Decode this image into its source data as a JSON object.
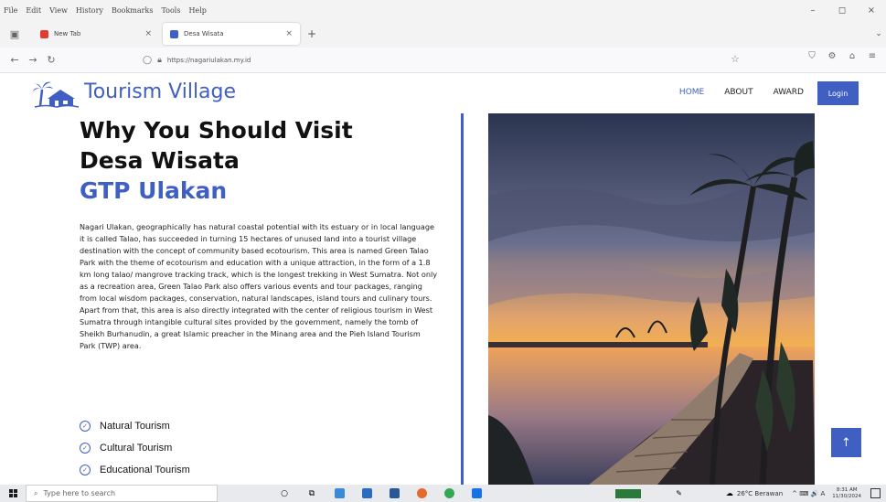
{
  "menubar": {
    "items": [
      "File",
      "Edit",
      "View",
      "History",
      "Bookmarks",
      "Tools",
      "Help"
    ]
  },
  "window_controls": {
    "minimize": "–",
    "maximize": "◻",
    "close": "×"
  },
  "tabs": [
    {
      "title": "New Tab",
      "favicon_color": "#e03c31",
      "close": "×"
    },
    {
      "title": "Desa Wisata",
      "favicon_color": "#3f5fc3",
      "close": "×"
    }
  ],
  "browser": {
    "new_tab": "+",
    "tab_list": "⌄",
    "back": "←",
    "forward": "→",
    "reload": "↻",
    "url": "https://nagariulakan.my.id",
    "bookmark": "☆",
    "toolbar": [
      "⛉",
      "⚙",
      "⌂",
      "≡"
    ]
  },
  "site": {
    "title": "Tourism Village",
    "nav": [
      "HOME",
      "ABOUT",
      "AWARD"
    ],
    "login": "Login",
    "accent_color": "#3f5fc3"
  },
  "content": {
    "heading_line1": "Why You Should Visit",
    "heading_line2": "Desa Wisata",
    "heading_line3": "GTP Ulakan",
    "paragraph": "Nagari Ulakan, geographically has natural coastal potential with its estuary or in local language it is called Talao, has succeeded in turning 15 hectares of unused land into a tourist village destination with the concept of community based ecotourism. This area is named Green Talao Park with the theme of ecotourism and education with a unique attraction, in the form of a 1.8 km long talao/ mangrove tracking track, which is the longest trekking in West Sumatra. Not only as a recreation area, Green Talao Park also offers various events and tour packages, ranging from local wisdom packages, conservation, natural landscapes, island tours and culinary tours. Apart from that, this area is also directly integrated with the center of religious tourism in West Sumatra through intangible cultural sites provided by the government, namely the tomb of Sheikh Burhanudin, a great Islamic preacher in the Minang area and the Pieh Island Tourism Park (TWP) area.",
    "features": [
      "Natural Tourism",
      "Cultural Tourism",
      "Educational Tourism"
    ],
    "back_to_top": "↑"
  },
  "taskbar": {
    "search_placeholder": "Type here to search",
    "weather": "26°C Berawan",
    "sys": "^ ⌨ 🔊 A",
    "time": "8:31 AM",
    "date": "11/30/2024"
  }
}
